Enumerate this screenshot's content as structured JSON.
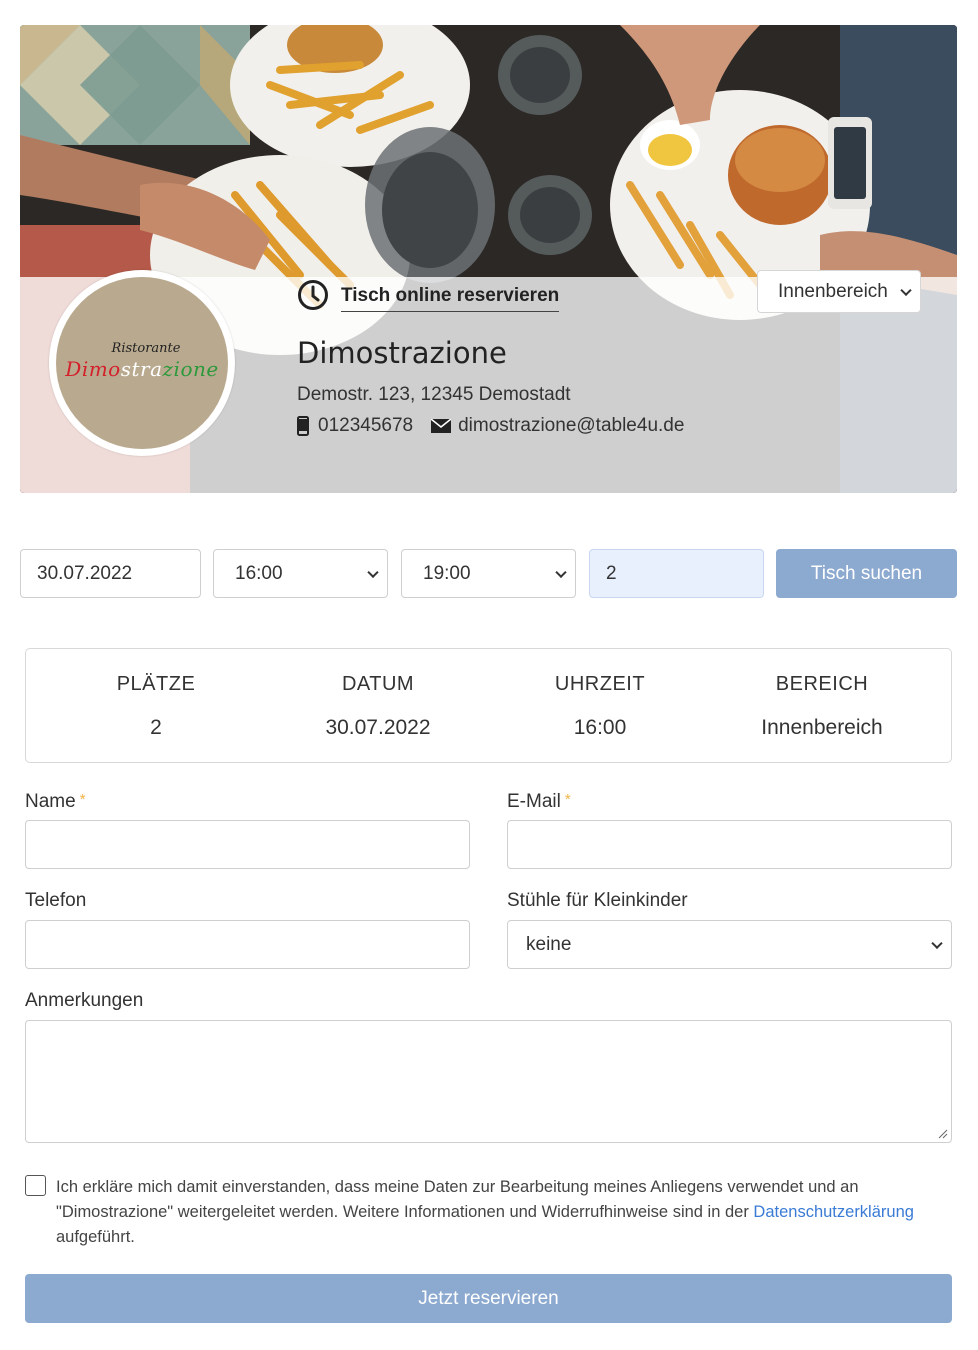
{
  "header": {
    "reserve_link": "Tisch online reservieren",
    "area_selected": "Innenbereich",
    "restaurant_name": "Dimostrazione",
    "address": "Demostr. 123, 12345 Demostadt",
    "phone": "012345678",
    "email": "dimostrazione@table4u.de",
    "logo": {
      "small_text": "Ristorante",
      "big_text_red": "Dimo",
      "big_text_white": "stra",
      "big_text_green": "zione"
    }
  },
  "search": {
    "date": "30.07.2022",
    "time_from": "16:00",
    "time_to": "19:00",
    "persons": "2",
    "button": "Tisch suchen"
  },
  "summary": {
    "columns": [
      {
        "label": "PLÄTZE",
        "value": "2"
      },
      {
        "label": "DATUM",
        "value": "30.07.2022"
      },
      {
        "label": "UHRZEIT",
        "value": "16:00"
      },
      {
        "label": "BEREICH",
        "value": "Innenbereich"
      }
    ]
  },
  "form": {
    "name_label": "Name",
    "email_label": "E-Mail",
    "required_mark": "*",
    "phone_label": "Telefon",
    "highchairs_label": "Stühle für Kleinkinder",
    "highchairs_value": "keine",
    "notes_label": "Anmerkungen",
    "consent_text_1": "Ich erkläre mich damit einverstanden, dass meine Daten zur Bearbeitung meines Anliegens verwendet und an \"Dimostrazione\" weitergeleitet werden. Weitere Informationen und Widerrufhinweise sind in der ",
    "consent_link": "Datenschutzerklärung",
    "consent_text_2": " aufgeführt.",
    "submit": "Jetzt reservieren"
  },
  "colors": {
    "button": "#8ca9d0",
    "link": "#3a7bd5",
    "required": "#f0b545",
    "persons_field": "#e8f0fe"
  }
}
